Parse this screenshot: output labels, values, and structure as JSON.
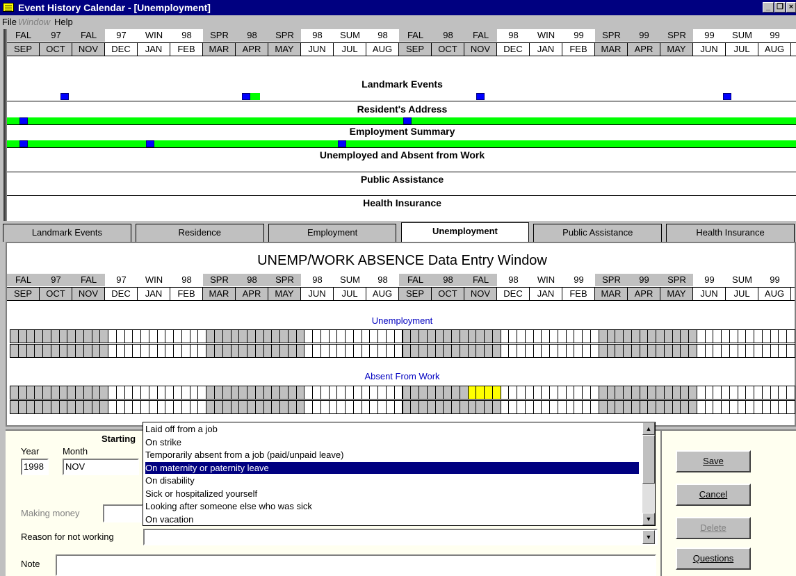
{
  "window": {
    "title": "Event History Calendar - [Unemployment]"
  },
  "menu": {
    "file": "File",
    "window": "Window",
    "help": "Help"
  },
  "calendar": {
    "seasons": [
      "FAL",
      "97",
      "FAL",
      "97",
      "WIN",
      "98",
      "SPR",
      "98",
      "SPR",
      "98",
      "SUM",
      "98",
      "FAL",
      "98",
      "FAL",
      "98",
      "WIN",
      "99",
      "SPR",
      "99",
      "SPR",
      "99",
      "SUM",
      "99"
    ],
    "months": [
      "SEP",
      "OCT",
      "NOV",
      "DEC",
      "JAN",
      "FEB",
      "MAR",
      "APR",
      "MAY",
      "JUN",
      "JUL",
      "AUG",
      "SEP",
      "OCT",
      "NOV",
      "DEC",
      "JAN",
      "FEB",
      "MAR",
      "APR",
      "MAY",
      "JUN",
      "JUL",
      "AUG"
    ],
    "shaded_columns": [
      0,
      1,
      2,
      6,
      7,
      8,
      12,
      13,
      14,
      18,
      19,
      20
    ]
  },
  "sections": {
    "landmark": "Landmark Events",
    "residence": "Resident's Address",
    "employment": "Employment Summary",
    "unemployed": "Unemployed and Absent from Work",
    "public": "Public Assistance",
    "health": "Health Insurance"
  },
  "tabs": [
    "Landmark Events",
    "Residence",
    "Employment",
    "Unemployment",
    "Public Assistance",
    "Health Insurance"
  ],
  "active_tab": 3,
  "entry": {
    "title": "UNEMP/WORK ABSENCE Data Entry Window",
    "unemployment_label": "Unemployment",
    "absent_label": "Absent From Work"
  },
  "form": {
    "starting_label": "Starting",
    "year_label": "Year",
    "month_label": "Month",
    "year_value": "1998",
    "month_value": "NOV",
    "making_money_label": "Making money",
    "reason_label": "Reason for not working",
    "reason_value": "",
    "note_label": "Note",
    "note_value": ""
  },
  "dropdown": {
    "items": [
      "Laid off from a job",
      "On strike",
      "Temporarily absent from a job (paid/unpaid leave)",
      "On maternity or paternity leave",
      "On disability",
      "Sick or hospitalized yourself",
      "Looking after someone else who was sick",
      "On vacation"
    ],
    "selected_index": 3
  },
  "buttons": {
    "save": "Save",
    "cancel": "Cancel",
    "delete": "Delete",
    "questions": "Questions"
  },
  "colors": {
    "titlebar": "#000080",
    "green": "#00ff00",
    "blue": "#0000ff",
    "yellow": "#ffff00",
    "label_blue": "#0000c0"
  }
}
